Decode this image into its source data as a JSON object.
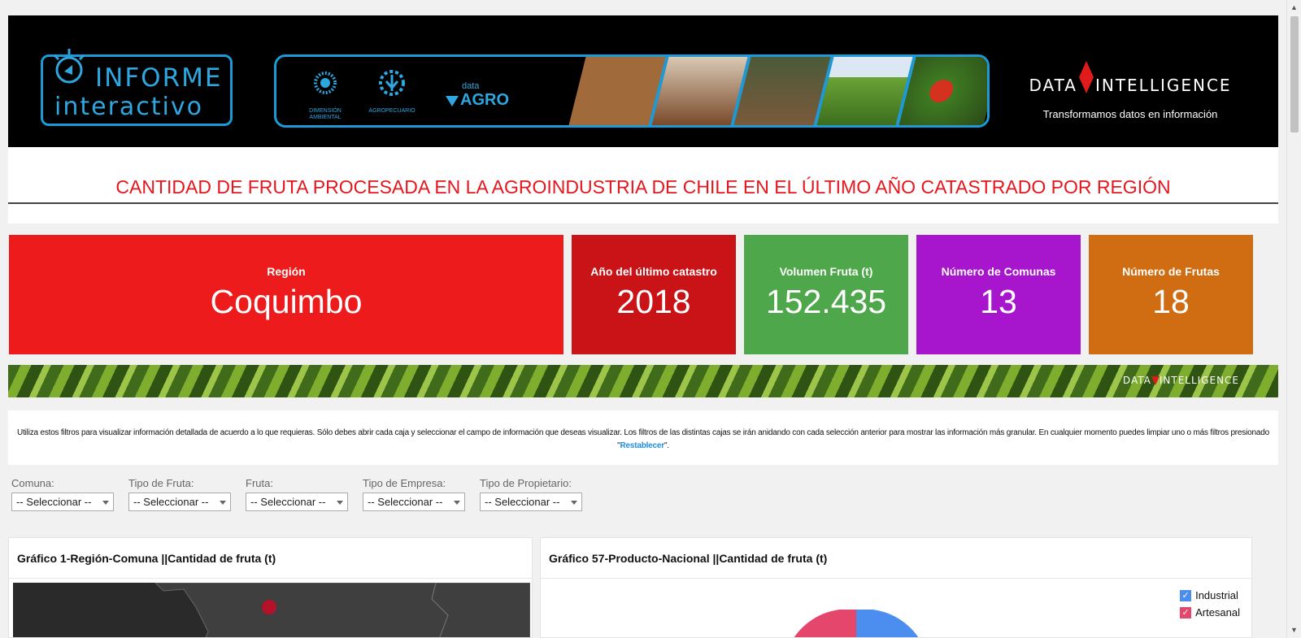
{
  "header": {
    "logo_line1": "INFORME",
    "logo_line2": "interactivo",
    "partners": [
      {
        "label": "DIMENSIÓN AMBIENTAL"
      },
      {
        "label": "AGROPECUARIO"
      }
    ],
    "dataagro_small": "data",
    "dataagro_big": "AGRO",
    "brand_left": "DATA",
    "brand_right": "INTELLIGENCE",
    "tagline": "Transformamos datos en información"
  },
  "title": "CANTIDAD DE FRUTA PROCESADA EN LA AGROINDUSTRIA DE CHILE EN EL ÚLTIMO AÑO CATASTRADO POR REGIÓN",
  "kpis": [
    {
      "label": "Región",
      "value": "Coquimbo",
      "color": "#ed1b1b"
    },
    {
      "label": "Año del último catastro",
      "value": "2018",
      "color": "#c91316"
    },
    {
      "label": "Volumen Fruta (t)",
      "value": "152.435",
      "color": "#4ea84b"
    },
    {
      "label": "Número de Comunas",
      "value": "13",
      "color": "#a715cc"
    },
    {
      "label": "Número de Frutas",
      "value": "18",
      "color": "#d06d13"
    }
  ],
  "leaf_banner": {
    "brand_left": "DATA",
    "brand_right": "INTELLIGENCE"
  },
  "info": {
    "text": "Utiliza estos filtros para visualizar información detallada de acuerdo a lo que requieras. Sólo debes abrir cada caja y seleccionar el campo de información que deseas visualizar. Los filtros de las distintas cajas se irán anidando con cada selección anterior para mostrar las información más granular. En cualquier momento puedes limpiar uno o más filtros presionado \"",
    "link": "Restablecer",
    "tail": "\"."
  },
  "filters": [
    {
      "label": "Comuna:",
      "value": "-- Seleccionar --"
    },
    {
      "label": "Tipo de Fruta:",
      "value": "-- Seleccionar --"
    },
    {
      "label": "Fruta:",
      "value": "-- Seleccionar --"
    },
    {
      "label": "Tipo de Empresa:",
      "value": "-- Seleccionar --"
    },
    {
      "label": "Tipo de Propietario:",
      "value": "-- Seleccionar --"
    }
  ],
  "panels": {
    "left_title": "Gráfico 1-Región-Comuna ||Cantidad de fruta (t)",
    "right_title": "Gráfico 57-Producto-Nacional ||Cantidad de fruta (t)",
    "legend": [
      {
        "label": "Industrial",
        "color": "#4b8ef0"
      },
      {
        "label": "Artesanal",
        "color": "#e5466c"
      }
    ]
  },
  "icons": {
    "checkbox": "✓",
    "scroll_up": "▲",
    "scroll_down": "▼"
  }
}
